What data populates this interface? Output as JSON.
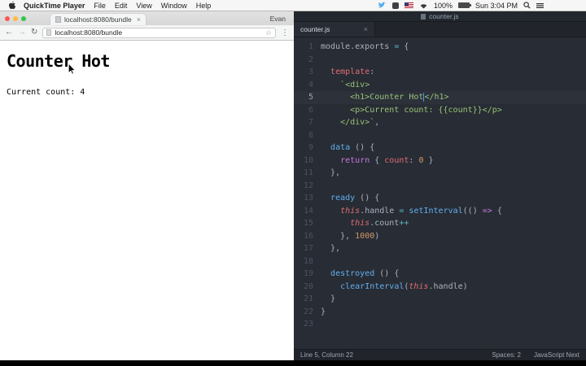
{
  "theme": {
    "editor_bg": "#282c34",
    "editor_chrome": "#21252b",
    "active_line_bg": "#2c313a",
    "fg_default": "#abb2bf",
    "red": "#e06c75",
    "string_green": "#98c379",
    "keyword_purple": "#c678dd",
    "function_blue": "#61afef",
    "number_orange": "#d19a66",
    "operator_cyan": "#56b6c2",
    "twitter_blue": "#55acee"
  },
  "menubar": {
    "app_name": "QuickTime Player",
    "menus": [
      "File",
      "Edit",
      "View",
      "Window",
      "Help"
    ],
    "battery": "100%",
    "clock": "Sun 3:04 PM"
  },
  "browser": {
    "tab_title": "localhost:8080/bundle",
    "profile_name": "Evan",
    "url": "localhost:8080/bundle",
    "back_icon": "←",
    "forward_icon": "→",
    "reload_icon": "↻",
    "star_icon": "☆",
    "menu_icon": "⋮",
    "tab_close_icon": "×",
    "page_heading": "Counter Hot",
    "page_text": "Current count: 4"
  },
  "editor": {
    "window_title": "counter.js",
    "tab_title": "counter.js",
    "tab_close_icon": "×",
    "active_line": 5,
    "status": {
      "position": "Line 5, Column 22",
      "spaces": "Spaces: 2",
      "language": "JavaScript Next"
    },
    "lines": [
      {
        "tokens": [
          [
            "module.exports ",
            "d"
          ],
          [
            "=",
            "op"
          ],
          [
            " {",
            "d"
          ]
        ]
      },
      {
        "tokens": []
      },
      {
        "tokens": [
          [
            "  ",
            "d"
          ],
          [
            "template",
            "red"
          ],
          [
            ":",
            "d"
          ]
        ]
      },
      {
        "tokens": [
          [
            "    ",
            "d"
          ],
          [
            "`<div>",
            "str"
          ]
        ]
      },
      {
        "tokens": [
          [
            "      <h1>Counter Hot",
            "str"
          ],
          [
            "",
            "cur"
          ],
          [
            "</h1>",
            "str"
          ]
        ]
      },
      {
        "tokens": [
          [
            "      <p>Current count: {{count}}</p>",
            "str"
          ]
        ]
      },
      {
        "tokens": [
          [
            "    </div>`",
            "str"
          ],
          [
            ",",
            "d"
          ]
        ]
      },
      {
        "tokens": []
      },
      {
        "tokens": [
          [
            "  ",
            "d"
          ],
          [
            "data",
            "fn"
          ],
          [
            " () {",
            "d"
          ]
        ]
      },
      {
        "tokens": [
          [
            "    ",
            "d"
          ],
          [
            "return",
            "kw"
          ],
          [
            " { ",
            "d"
          ],
          [
            "count",
            "red"
          ],
          [
            ": ",
            "d"
          ],
          [
            "0",
            "num"
          ],
          [
            " }",
            "d"
          ]
        ]
      },
      {
        "tokens": [
          [
            "  },",
            "d"
          ]
        ]
      },
      {
        "tokens": []
      },
      {
        "tokens": [
          [
            "  ",
            "d"
          ],
          [
            "ready",
            "fn"
          ],
          [
            " () {",
            "d"
          ]
        ]
      },
      {
        "tokens": [
          [
            "    ",
            "d"
          ],
          [
            "this",
            "this"
          ],
          [
            ".handle ",
            "d"
          ],
          [
            "=",
            "op"
          ],
          [
            " ",
            "d"
          ],
          [
            "setInterval",
            "fn"
          ],
          [
            "(() ",
            "d"
          ],
          [
            "=>",
            "kw"
          ],
          [
            " {",
            "d"
          ]
        ]
      },
      {
        "tokens": [
          [
            "      ",
            "d"
          ],
          [
            "this",
            "this"
          ],
          [
            ".count",
            "d"
          ],
          [
            "++",
            "op"
          ]
        ]
      },
      {
        "tokens": [
          [
            "    }, ",
            "d"
          ],
          [
            "1000",
            "num"
          ],
          [
            ")",
            "d"
          ]
        ]
      },
      {
        "tokens": [
          [
            "  },",
            "d"
          ]
        ]
      },
      {
        "tokens": []
      },
      {
        "tokens": [
          [
            "  ",
            "d"
          ],
          [
            "destroyed",
            "fn"
          ],
          [
            " () {",
            "d"
          ]
        ]
      },
      {
        "tokens": [
          [
            "    ",
            "d"
          ],
          [
            "clearInterval",
            "fn"
          ],
          [
            "(",
            "d"
          ],
          [
            "this",
            "this"
          ],
          [
            ".handle)",
            "d"
          ]
        ]
      },
      {
        "tokens": [
          [
            "  }",
            "d"
          ]
        ]
      },
      {
        "tokens": [
          [
            "}",
            "d"
          ]
        ]
      },
      {
        "tokens": []
      }
    ]
  }
}
